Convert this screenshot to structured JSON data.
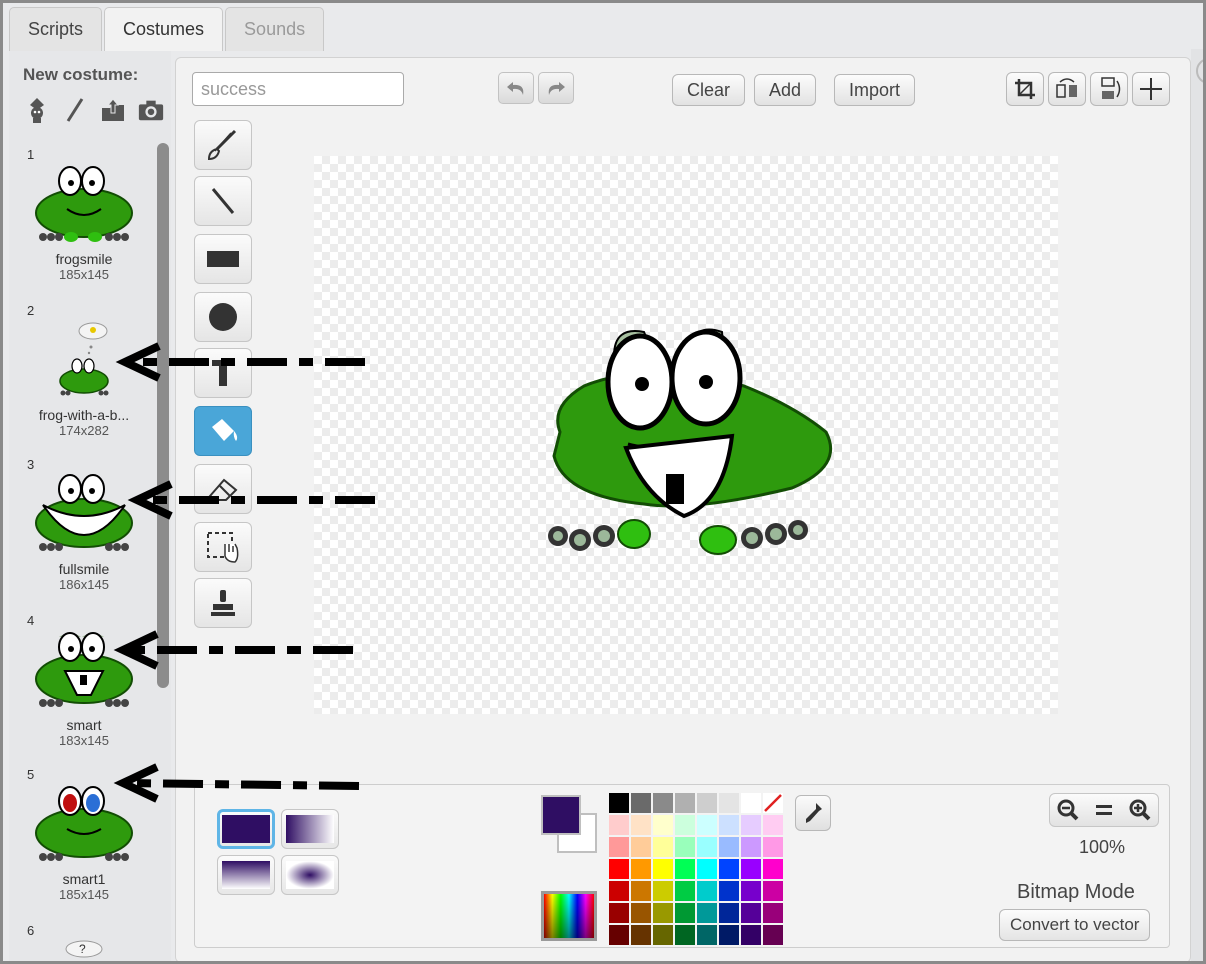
{
  "tabs": [
    {
      "label": "Scripts"
    },
    {
      "label": "Costumes"
    },
    {
      "label": "Sounds"
    }
  ],
  "sidebar": {
    "new_costume_label": "New costume:",
    "new_icons": [
      "paint-from-library-icon",
      "paint-brush-icon",
      "upload-icon",
      "camera-icon"
    ],
    "costumes": [
      {
        "number": "1",
        "name": "frogsmile",
        "size": "185x145"
      },
      {
        "number": "2",
        "name": "frog-with-a-b...",
        "size": "174x282"
      },
      {
        "number": "3",
        "name": "fullsmile",
        "size": "186x145"
      },
      {
        "number": "4",
        "name": "smart",
        "size": "183x145"
      },
      {
        "number": "5",
        "name": "smart1",
        "size": "185x145"
      },
      {
        "number": "6",
        "name": "",
        "size": ""
      }
    ]
  },
  "editor": {
    "costume_name": "success",
    "clear_label": "Clear",
    "add_label": "Add",
    "import_label": "Import",
    "tools": [
      "brush-icon",
      "line-icon",
      "rectangle-icon",
      "ellipse-icon",
      "text-icon",
      "fill-bucket-icon",
      "eraser-icon",
      "select-icon",
      "stamp-icon"
    ],
    "active_tool": "fill-bucket-icon",
    "zoom_level": "100%",
    "mode_label": "Bitmap Mode",
    "convert_label": "Convert to vector"
  },
  "colors": {
    "primary": "#2f0e63",
    "secondary": "#ffffff",
    "frog_green": "#2e9a0d",
    "palette": [
      "#000000",
      "#6a6a6a",
      "#8a8a8a",
      "#b0b0b0",
      "#cecece",
      "#e4e4e4",
      "#ffffff",
      "transparent",
      "#ffcccc",
      "#ffe2c6",
      "#ffffcc",
      "#ccffdd",
      "#ccffff",
      "#cce0ff",
      "#e6ccff",
      "#ffccf2",
      "#ff9999",
      "#ffcc99",
      "#ffff99",
      "#99ffbb",
      "#99ffff",
      "#99bbff",
      "#cc99ff",
      "#ff99e6",
      "#ff0000",
      "#ff9900",
      "#ffff00",
      "#00ff55",
      "#00ffff",
      "#0044ff",
      "#9900ff",
      "#ff00cc",
      "#cc0000",
      "#cc7700",
      "#cccc00",
      "#00cc44",
      "#00cccc",
      "#0033cc",
      "#7700cc",
      "#cc00a3",
      "#990000",
      "#995500",
      "#999900",
      "#009933",
      "#009999",
      "#002699",
      "#550099",
      "#99007a",
      "#660000",
      "#663300",
      "#666600",
      "#006622",
      "#006666",
      "#001a66",
      "#330066",
      "#660052"
    ]
  }
}
